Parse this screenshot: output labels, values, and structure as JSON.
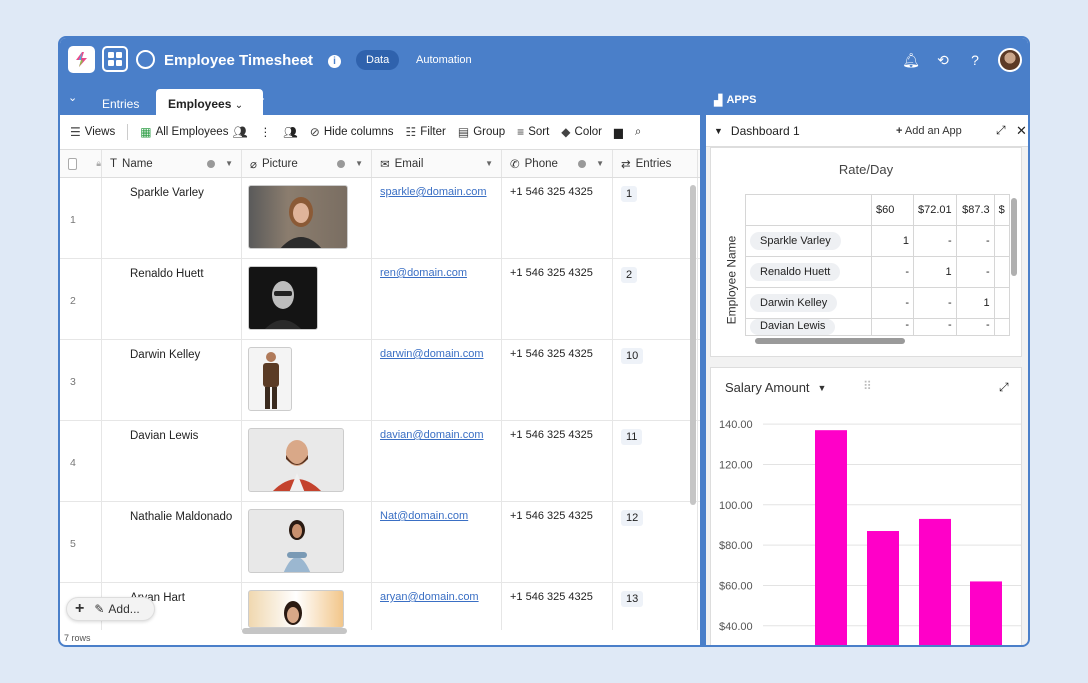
{
  "topbar": {
    "title": "Employee Timesheet",
    "tabs": [
      "Data",
      "Automation"
    ],
    "icons": [
      "bell-icon",
      "history-icon",
      "help-icon"
    ]
  },
  "tabs": {
    "entries": "Entries",
    "employees": "Employees"
  },
  "toolbar": {
    "views": "Views",
    "all_employees": "All Employees",
    "hide_columns": "Hide columns",
    "filter": "Filter",
    "group": "Group",
    "sort": "Sort",
    "color": "Color"
  },
  "columns": {
    "name": "Name",
    "picture": "Picture",
    "email": "Email",
    "phone": "Phone",
    "entries": "Entries"
  },
  "rows": [
    {
      "num": "1",
      "name": "Sparkle Varley",
      "email": "sparkle@domain.com",
      "phone": "+1 546 325 4325",
      "entries": "1"
    },
    {
      "num": "2",
      "name": "Renaldo Huett",
      "email": "ren@domain.com",
      "phone": "+1 546 325 4325",
      "entries": "2"
    },
    {
      "num": "3",
      "name": "Darwin Kelley",
      "email": "darwin@domain.com",
      "phone": "+1 546 325 4325",
      "entries": "10"
    },
    {
      "num": "4",
      "name": "Davian Lewis",
      "email": "davian@domain.com",
      "phone": "+1 546 325 4325",
      "entries": "11"
    },
    {
      "num": "5",
      "name": "Nathalie Maldonado",
      "email": "Nat@domain.com",
      "phone": "+1 546 325 4325",
      "entries": "12"
    },
    {
      "num": "",
      "name": "Aryan Hart",
      "email": "aryan@domain.com",
      "phone": "+1 546 325 4325",
      "entries": "13"
    }
  ],
  "footer": {
    "add": "Add...",
    "rows_count": "7 rows"
  },
  "apps": {
    "header": "APPS",
    "dashboard": "Dashboard 1",
    "add_app": "Add an App"
  },
  "pivot": {
    "title": "Rate/Day",
    "ylabel": "Employee Name",
    "columns": [
      "",
      "$60",
      "$72.01",
      "$87.3",
      "$"
    ],
    "rows": [
      {
        "name": "Sparkle Varley",
        "cells": [
          "1",
          "-",
          "-"
        ]
      },
      {
        "name": "Renaldo Huett",
        "cells": [
          "-",
          "1",
          "-"
        ]
      },
      {
        "name": "Darwin Kelley",
        "cells": [
          "-",
          "-",
          "1"
        ]
      },
      {
        "name": "Davian Lewis",
        "cells": [
          "-",
          "-",
          "-"
        ]
      }
    ]
  },
  "chart_data": {
    "type": "bar",
    "title": "Salary Amount",
    "y_ticks": [
      "140.00",
      "120.00",
      "100.00",
      "$80.00",
      "$60.00",
      "$40.00"
    ],
    "values": [
      137,
      87,
      93,
      62
    ],
    "ylim": [
      28,
      148
    ],
    "bar_color": "#ff00c8"
  }
}
